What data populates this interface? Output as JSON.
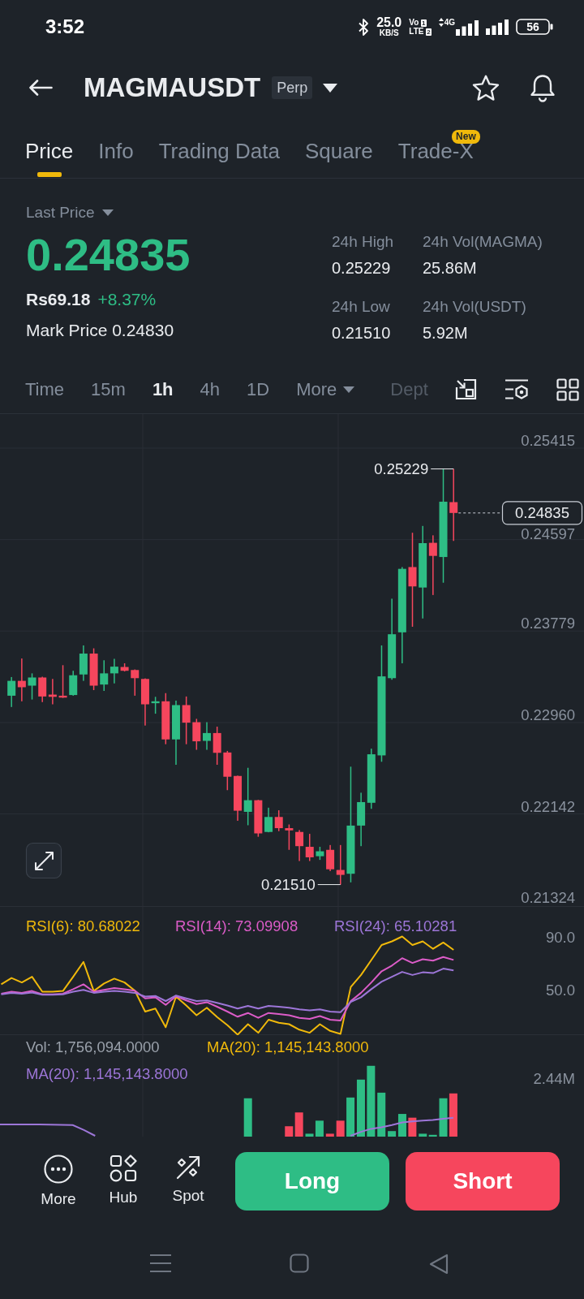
{
  "status_bar": {
    "time": "3:52",
    "speed": "25.0",
    "speed_unit": "KB/S",
    "volte": {
      "top": "Vo",
      "top_sim": "1",
      "bottom": "LTE",
      "bottom_sim": "2"
    },
    "network_type": "4G",
    "battery": "56"
  },
  "header": {
    "title": "MAGMAUSDT",
    "contract_type": "Perp"
  },
  "tabs": [
    {
      "label": "Price",
      "selected": true
    },
    {
      "label": "Info",
      "selected": false
    },
    {
      "label": "Trading Data",
      "selected": false
    },
    {
      "label": "Square",
      "selected": false
    },
    {
      "label": "Trade-X",
      "selected": false,
      "badge": "New"
    }
  ],
  "ticker": {
    "price_type": "Last Price",
    "last_price": "0.24835",
    "fiat_price": "Rs69.18",
    "change": "+8.37%",
    "mark_price": "Mark Price 0.24830",
    "stats": [
      {
        "label": "24h High",
        "value": "0.25229"
      },
      {
        "label": "24h Vol(MAGMA)",
        "value": "25.86M"
      },
      {
        "label": "24h Low",
        "value": "0.21510"
      },
      {
        "label": "24h Vol(USDT)",
        "value": "5.92M"
      }
    ]
  },
  "intervals": [
    {
      "label": "Time",
      "selected": false,
      "kind": "option"
    },
    {
      "label": "15m",
      "selected": false,
      "kind": "option"
    },
    {
      "label": "1h",
      "selected": true,
      "kind": "option"
    },
    {
      "label": "4h",
      "selected": false,
      "kind": "option"
    },
    {
      "label": "1D",
      "selected": false,
      "kind": "option"
    },
    {
      "label": "More",
      "selected": false,
      "kind": "dropdown"
    },
    {
      "label": "Dept",
      "selected": false,
      "kind": "overflow"
    }
  ],
  "price_chart": {
    "high_label": "0.25229",
    "low_label": "0.21510",
    "last_price_tag": "0.24835",
    "chart_data": {
      "type": "candlestick",
      "ohlc": [
        [
          0.232,
          0.23367,
          0.23099,
          0.23333
        ],
        [
          0.23333,
          0.23533,
          0.2315,
          0.23276
        ],
        [
          0.2329,
          0.234,
          0.23166,
          0.23363
        ],
        [
          0.23363,
          0.2337,
          0.23143,
          0.23193
        ],
        [
          0.2321,
          0.2335,
          0.23123,
          0.2319
        ],
        [
          0.232,
          0.23473,
          0.2318,
          0.23183
        ],
        [
          0.23206,
          0.23423,
          0.232,
          0.23383
        ],
        [
          0.2339,
          0.2365,
          0.23333,
          0.23577
        ],
        [
          0.23577,
          0.23624,
          0.2325,
          0.2329
        ],
        [
          0.233,
          0.23517,
          0.23243,
          0.234
        ],
        [
          0.234,
          0.2353,
          0.2331,
          0.2346
        ],
        [
          0.23457,
          0.2349,
          0.23417,
          0.23423
        ],
        [
          0.2343,
          0.23435,
          0.232,
          0.23357
        ],
        [
          0.2335,
          0.23355,
          0.22933,
          0.23123
        ],
        [
          0.23133,
          0.2319,
          0.23039,
          0.2315
        ],
        [
          0.2315,
          0.23223,
          0.22766,
          0.22809
        ],
        [
          0.22809,
          0.23156,
          0.22582,
          0.23116
        ],
        [
          0.23116,
          0.23193,
          0.22766,
          0.22959
        ],
        [
          0.22963,
          0.22993,
          0.22716,
          0.22792
        ],
        [
          0.22796,
          0.22963,
          0.22716,
          0.22866
        ],
        [
          0.22866,
          0.22923,
          0.22582,
          0.22689
        ],
        [
          0.22692,
          0.22706,
          0.22355,
          0.22475
        ],
        [
          0.22482,
          0.22485,
          0.22081,
          0.22171
        ],
        [
          0.22161,
          0.22555,
          0.22041,
          0.22265
        ],
        [
          0.22265,
          0.22268,
          0.21938,
          0.21968
        ],
        [
          0.21981,
          0.22198,
          0.21978,
          0.22115
        ],
        [
          0.22115,
          0.22175,
          0.21988,
          0.22015
        ],
        [
          0.22015,
          0.22048,
          0.21821,
          0.21995
        ],
        [
          0.21981,
          0.21998,
          0.21721,
          0.21854
        ],
        [
          0.21848,
          0.21964,
          0.21721,
          0.21754
        ],
        [
          0.21764,
          0.21848,
          0.21731,
          0.21808
        ],
        [
          0.21821,
          0.21864,
          0.21631,
          0.21647
        ],
        [
          0.21641,
          0.21864,
          0.2151,
          0.21597
        ],
        [
          0.21607,
          0.22565,
          0.2153,
          0.22038
        ],
        [
          0.22038,
          0.22332,
          0.21854,
          0.22248
        ],
        [
          0.22242,
          0.22726,
          0.22188,
          0.22676
        ],
        [
          0.22666,
          0.2365,
          0.22609,
          0.23373
        ],
        [
          0.23357,
          0.24068,
          0.23343,
          0.2375
        ],
        [
          0.23767,
          0.24351,
          0.2349,
          0.24335
        ],
        [
          0.24351,
          0.24658,
          0.23817,
          0.24178
        ],
        [
          0.24168,
          0.24719,
          0.23891,
          0.24565
        ],
        [
          0.24568,
          0.24635,
          0.24101,
          0.24451
        ],
        [
          0.24441,
          0.25229,
          0.24211,
          0.24936
        ],
        [
          0.24932,
          0.25229,
          0.24585,
          0.24835
        ]
      ],
      "ylim": [
        0.21318,
        0.2572
      ],
      "yticks": [
        0.25415,
        0.24597,
        0.23779,
        {
          "value": 0.2296,
          "label": "0.22960"
        },
        0.22142,
        0.21324
      ],
      "grid": true
    }
  },
  "rsi_chart": {
    "chart_data": {
      "type": "line",
      "categories": [
        null,
        null,
        null,
        null,
        null,
        null,
        null,
        null,
        null,
        null,
        null,
        null,
        null,
        null,
        null,
        null,
        null,
        null,
        null,
        null,
        null,
        null,
        null,
        null,
        null,
        null,
        null,
        null,
        null,
        null,
        null,
        null,
        null,
        null,
        null,
        null,
        null,
        null,
        null,
        null,
        null,
        null,
        null,
        null,
        null
      ],
      "ylim": [
        16,
        114
      ],
      "yticks": [
        {
          "value": 90,
          "label": "90.0"
        },
        {
          "value": 50,
          "label": "50.0"
        }
      ],
      "grid": true,
      "series": [
        {
          "name": "RSI(6): 80.68022",
          "color": "#f0b90b",
          "values": [
            54.6,
            59.4,
            56.0,
            60.3,
            49.0,
            49.0,
            49.5,
            60.3,
            71.6,
            49.5,
            55.2,
            58.9,
            56.0,
            49.8,
            33.9,
            36.2,
            22.0,
            45.3,
            38.5,
            31.1,
            36.8,
            29.7,
            23.5,
            16.4,
            24.3,
            17.8,
            27.7,
            25.4,
            24.3,
            20.1,
            17.8,
            24.3,
            19.2,
            16.9,
            52.6,
            61.7,
            73.0,
            84.4,
            87.2,
            90.9,
            84.4,
            87.2,
            81.5,
            86.3,
            80.7
          ]
        },
        {
          "name": "RSI(14): 73.09908",
          "color": "#dc5cc8",
          "values": [
            47.5,
            49.0,
            48.1,
            49.5,
            47.0,
            47.0,
            47.5,
            50.9,
            54.6,
            49.0,
            50.4,
            51.8,
            50.9,
            49.8,
            43.9,
            44.7,
            39.0,
            45.6,
            42.4,
            39.6,
            41.0,
            37.6,
            33.9,
            30.0,
            32.8,
            29.1,
            32.8,
            32.0,
            31.1,
            29.1,
            28.3,
            30.5,
            27.7,
            27.1,
            41.9,
            48.1,
            56.0,
            64.5,
            68.8,
            74.4,
            70.8,
            73.6,
            72.5,
            75.3,
            73.1
          ]
        },
        {
          "name": "RSI(24): 65.10281",
          "color": "#9d76d8",
          "values": [
            47.0,
            48.1,
            47.5,
            48.4,
            46.7,
            46.7,
            47.0,
            49.0,
            50.4,
            48.1,
            49.0,
            49.5,
            49.0,
            48.1,
            45.3,
            45.8,
            41.9,
            46.1,
            43.9,
            41.9,
            42.4,
            40.5,
            38.5,
            36.2,
            38.2,
            36.2,
            38.2,
            37.6,
            36.8,
            35.6,
            34.8,
            35.6,
            33.9,
            33.4,
            41.3,
            44.7,
            50.9,
            56.6,
            60.3,
            64.0,
            61.7,
            63.7,
            63.1,
            66.5,
            65.1
          ]
        }
      ]
    }
  },
  "volume_panel": {
    "legend": [
      {
        "label": "Vol: 1,756,094.0000",
        "color": "#9aa1ab"
      },
      {
        "label": "MA(20): 1,145,143.8000",
        "color": "#f0b90b"
      },
      {
        "label": "MA(20): 1,145,143.8000",
        "color": "#9d76d8"
      }
    ],
    "axis_label": "2.44M"
  },
  "actions": [
    {
      "label": "More"
    },
    {
      "label": "Hub"
    },
    {
      "label": "Spot"
    }
  ],
  "trade_buttons": [
    {
      "label": "Long",
      "kind": "buy"
    },
    {
      "label": "Short",
      "kind": "sell"
    }
  ]
}
